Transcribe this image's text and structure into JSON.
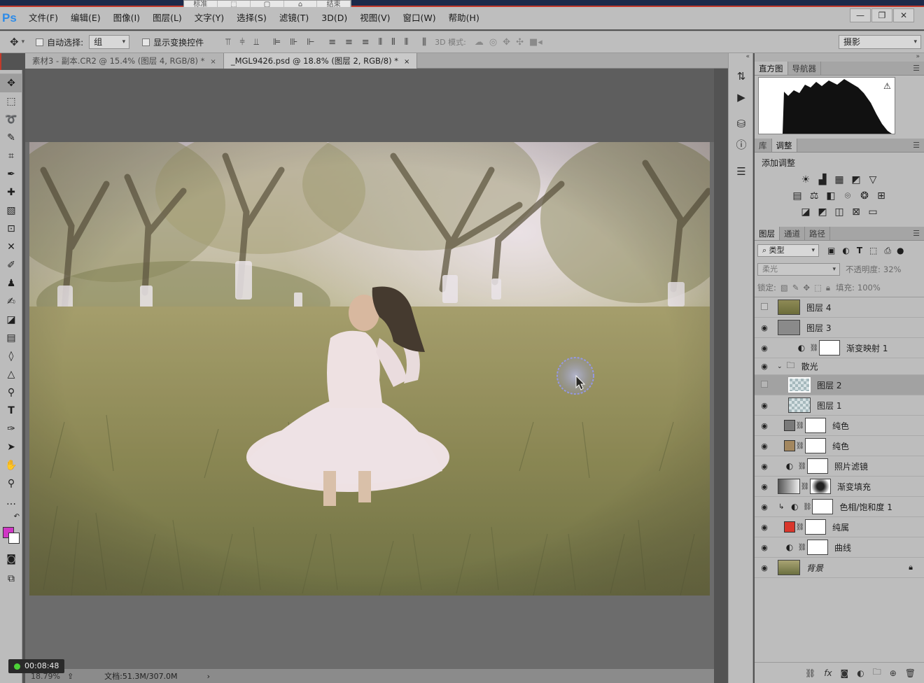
{
  "floating_bar": {
    "items": [
      "标准",
      "",
      "",
      "",
      "结束"
    ]
  },
  "app": {
    "logo": "Ps"
  },
  "menu": [
    "文件(F)",
    "编辑(E)",
    "图像(I)",
    "图层(L)",
    "文字(Y)",
    "选择(S)",
    "滤镜(T)",
    "3D(D)",
    "视图(V)",
    "窗口(W)",
    "帮助(H)"
  ],
  "window_controls": {
    "minimize": "—",
    "restore": "❐",
    "close": "✕"
  },
  "options": {
    "auto_select_label": "自动选择:",
    "auto_select_value": "组",
    "show_transform_label": "显示变换控件",
    "mode3d_label": "3D 模式:",
    "workspace": "摄影"
  },
  "doc_tabs": [
    {
      "title": "素材3 - 副本.CR2 @ 15.4% (图层 4, RGB/8) *",
      "close": "×"
    },
    {
      "title": "_MGL9426.psd @ 18.8% (图层 2, RGB/8) *",
      "close": "×"
    }
  ],
  "status": {
    "zoom": "18.79%",
    "doc": "文档:51.3M/307.0M",
    "timer": "00:08:48"
  },
  "panels": {
    "histogram_tabs": [
      "直方图",
      "导航器"
    ],
    "adjust_tabs": [
      "库",
      "调整"
    ],
    "adjust_title": "添加调整",
    "layers_tabs": [
      "图层",
      "通道",
      "路径"
    ],
    "filter_kind": "类型",
    "blend_mode": "柔光",
    "opacity_label": "不透明度:",
    "opacity_value": "32%",
    "lock_label": "锁定:",
    "fill_label": "填充:",
    "fill_value": "100%"
  },
  "layers": [
    {
      "name": "图层 4",
      "visible": false,
      "type": "image"
    },
    {
      "name": "图层 3",
      "visible": true,
      "type": "gray"
    },
    {
      "name": "渐变映射 1",
      "visible": true,
      "type": "adjust"
    },
    {
      "name": "散光",
      "visible": true,
      "type": "group"
    },
    {
      "name": "图层 2",
      "visible": false,
      "type": "checker",
      "selected": true
    },
    {
      "name": "图层 1",
      "visible": true,
      "type": "checker"
    },
    {
      "name": "纯色",
      "visible": true,
      "type": "fill",
      "color": "#7a7a7a"
    },
    {
      "name": "纯色",
      "visible": true,
      "type": "fill",
      "color": "#a3875f"
    },
    {
      "name": "照片滤镜",
      "visible": true,
      "type": "adjust"
    },
    {
      "name": "渐变填充",
      "visible": true,
      "type": "gradient"
    },
    {
      "name": "色相/饱和度 1",
      "visible": true,
      "type": "adjust",
      "clipped": true
    },
    {
      "name": "纯属",
      "visible": true,
      "type": "fill",
      "color": "#d9362b"
    },
    {
      "name": "曲线",
      "visible": true,
      "type": "adjust"
    },
    {
      "name": "背景",
      "visible": true,
      "type": "image",
      "locked": true
    }
  ],
  "colors": {
    "foreground": "#cf37c5",
    "background": "#ffffff",
    "accent_red": "#c23a2b"
  }
}
